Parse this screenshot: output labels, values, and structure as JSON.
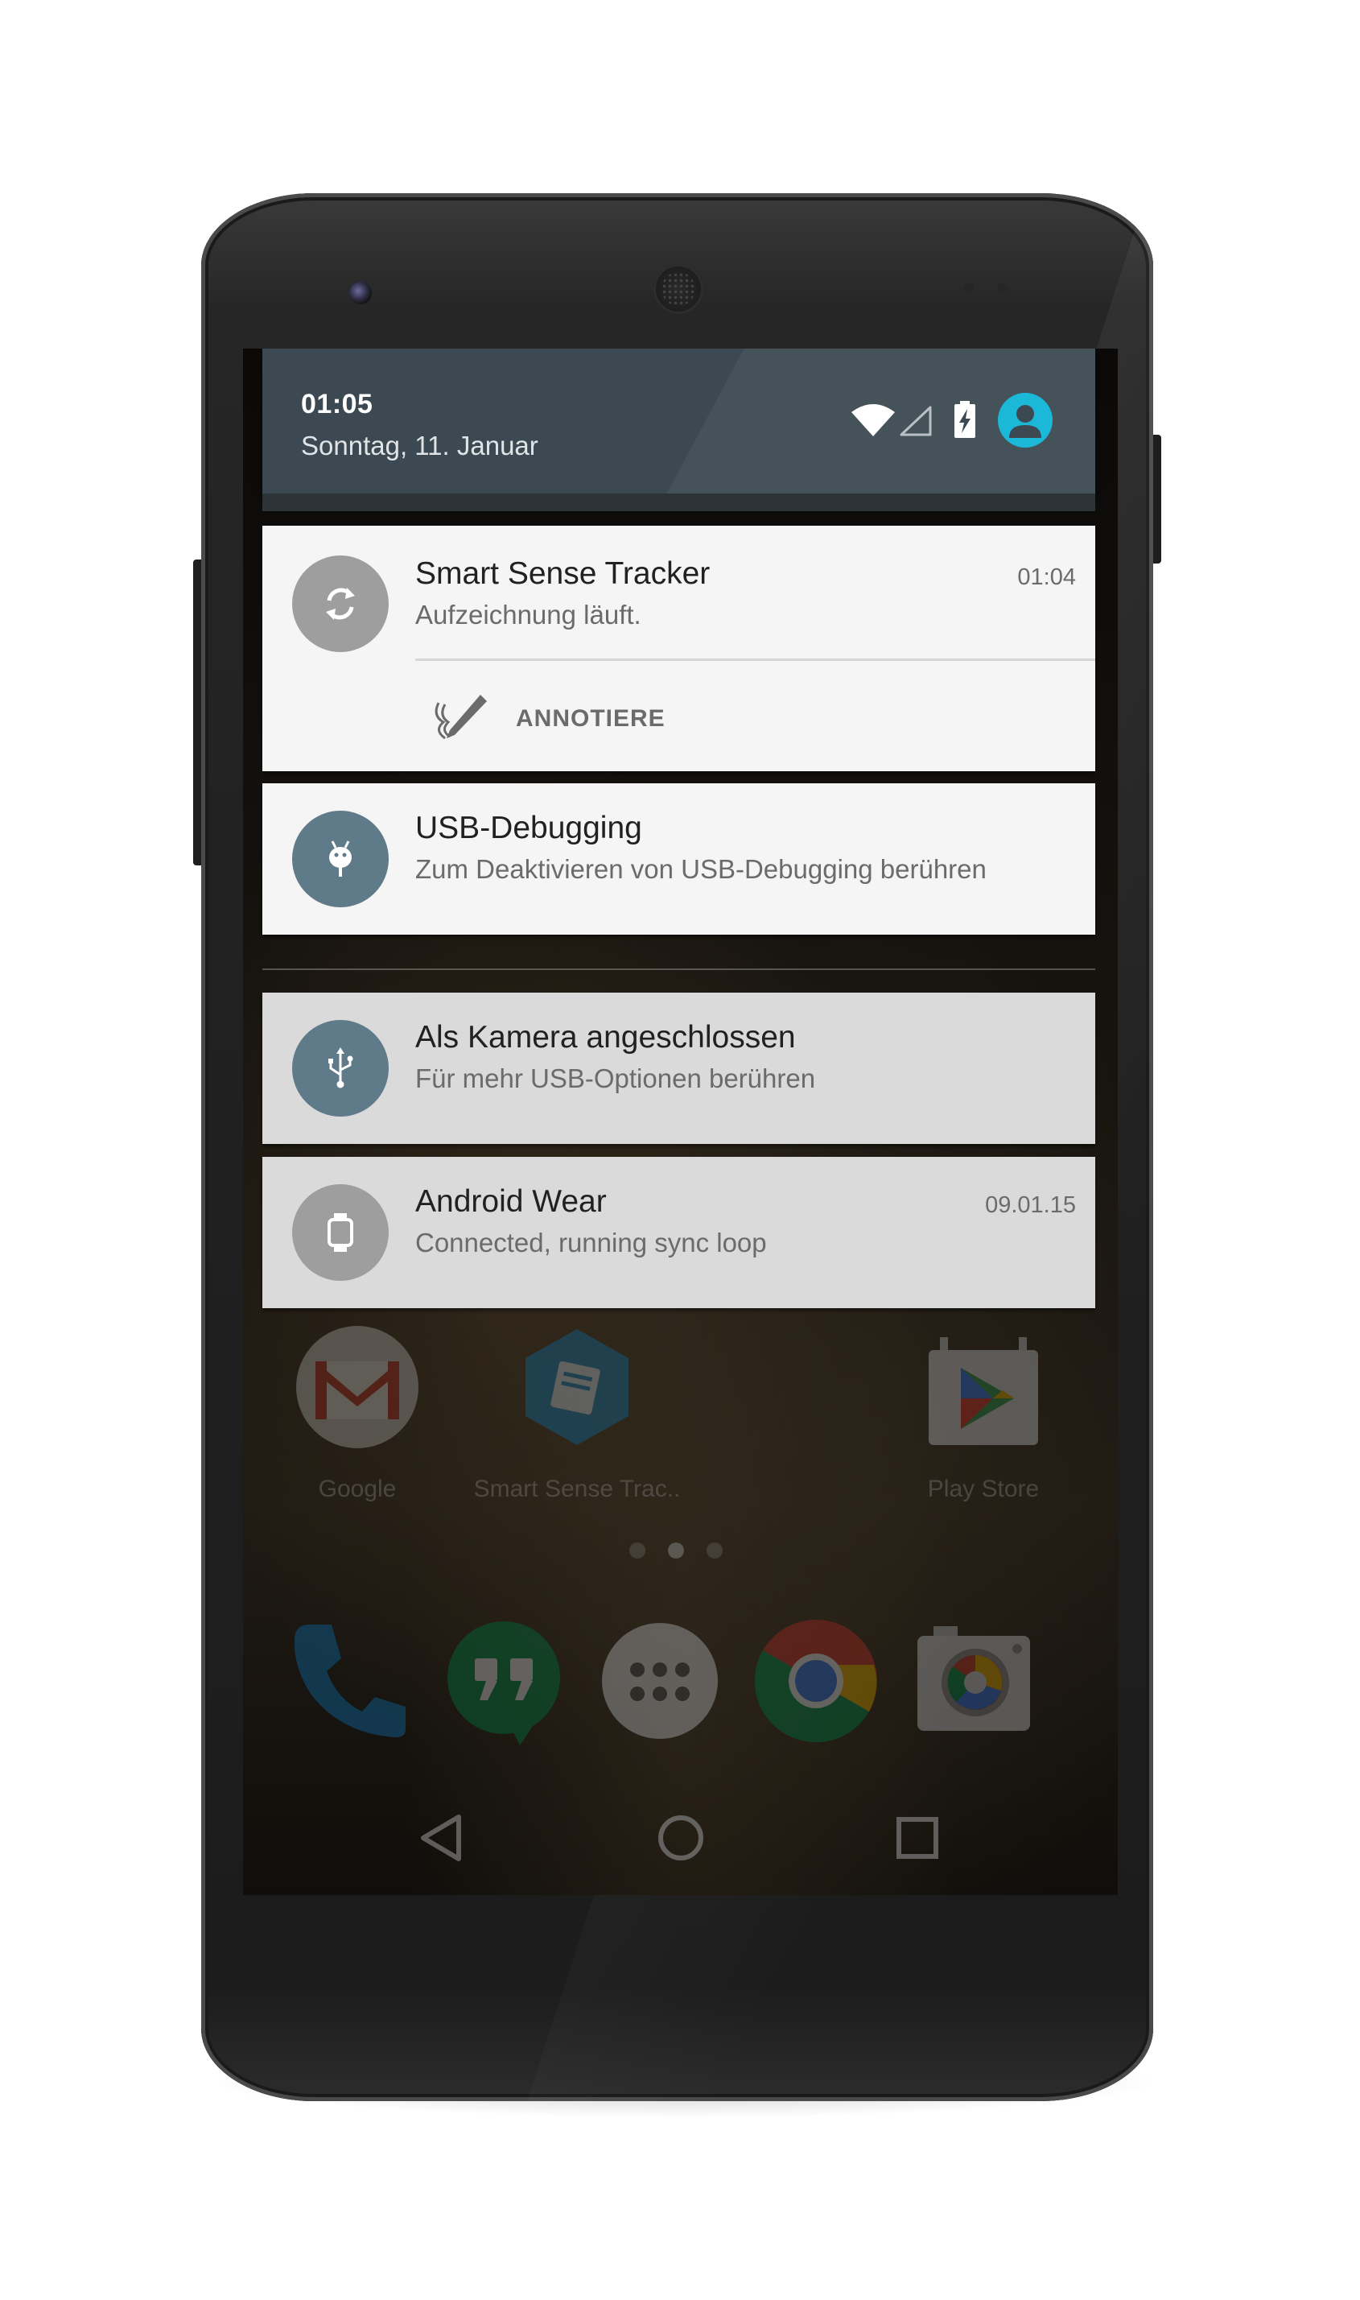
{
  "status_header": {
    "time": "01:05",
    "date": "Sonntag, 11. Januar"
  },
  "notifications": [
    {
      "title": "Smart Sense Tracker",
      "text": "Aufzeichnung läuft.",
      "time": "01:04",
      "icon": "sync-icon",
      "action_label": "ANNOTIERE"
    },
    {
      "title": "USB-Debugging",
      "text": "Zum Deaktivieren von USB-Debugging berühren",
      "icon": "android-bug-icon"
    },
    {
      "title": "Als Kamera angeschlossen",
      "text": "Für mehr USB-Optionen berühren",
      "icon": "usb-icon"
    },
    {
      "title": "Android Wear",
      "text": "Connected, running sync loop",
      "time": "09.01.15",
      "icon": "watch-icon"
    }
  ],
  "home_apps": [
    {
      "label": "Google",
      "icon": "gmail-icon"
    },
    {
      "label": "Smart Sense Trac..",
      "icon": "book-icon"
    },
    {
      "label": "Play Store",
      "icon": "play-store-icon"
    }
  ],
  "dock": [
    {
      "icon": "phone-icon"
    },
    {
      "icon": "hangouts-icon"
    },
    {
      "icon": "app-drawer-icon"
    },
    {
      "icon": "chrome-icon"
    },
    {
      "icon": "camera-icon"
    }
  ],
  "navigation": [
    "back-icon",
    "home-icon",
    "recents-icon"
  ],
  "colors": {
    "header_bg": "#3d4952",
    "accent_avatar": "#1cb8d8",
    "notification_icon_slate": "#5f7a88",
    "notification_icon_gray": "#9e9e9e"
  }
}
